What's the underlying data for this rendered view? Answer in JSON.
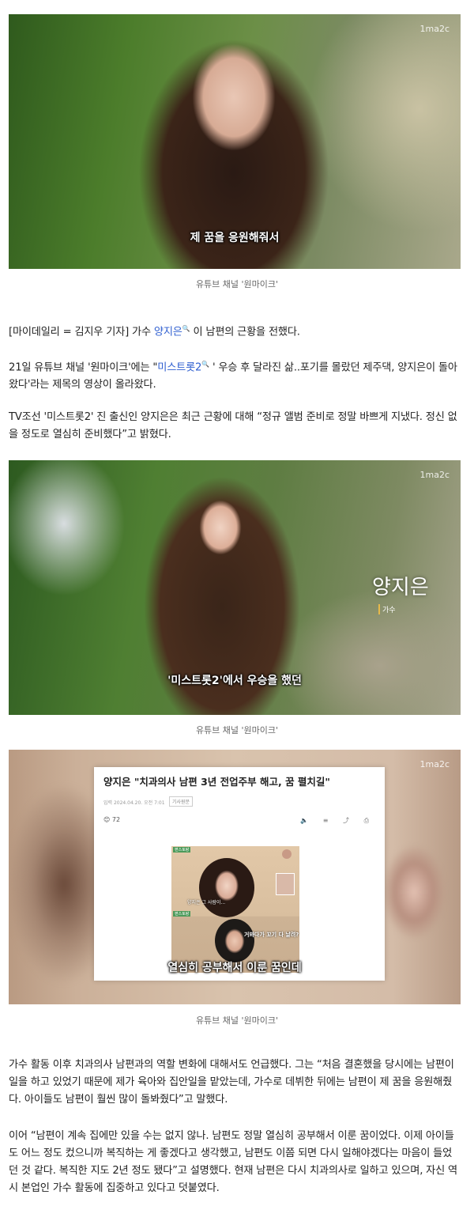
{
  "image1": {
    "watermark": "1ma2c",
    "subtitle": "제 꿈을 응원해줘서",
    "caption": "유튜브 채널 '원마이크'"
  },
  "paragraph1": {
    "prefix": "[마이데일리 = 김지우 기자] 가수 ",
    "link": "양지은",
    "suffix": " 이 남편의 근황을 전했다."
  },
  "paragraph2": {
    "prefix": "21일 유튜브 채널 '원마이크'에는 \"",
    "link": "미스트롯2",
    "suffix": " ' 우승 후 달라진 삶..포기를 몰랐던 제주댁, 양지은이 돌아왔다'라는 제목의 영상이 올라왔다."
  },
  "paragraph3": "TV조선 '미스트롯2' 진 출신인 양지은은 최근 근황에 대해 “정규 앨범 준비로 정말 바쁘게 지냈다. 정신 없을 정도로 열심히 준비했다”고 밝혔다.",
  "image2": {
    "watermark": "1ma2c",
    "name": "양지은",
    "role": "가수",
    "subtitle": "'미스트롯2'에서 우승을 했던",
    "caption": "유튜브 채널 '원마이크'"
  },
  "image3": {
    "watermark": "1ma2c",
    "article_title": "양지은 \"치과의사 남편 3년 전업주부 해고, 꿈 펼치길\"",
    "article_meta": "입력 2024.04.20. 오전 7:01",
    "article_category": "기사원문",
    "reaction": "😊 72",
    "tools": "🔈 ≡ ⤴ ⎙",
    "still_label_top": "편스토랑",
    "still_label_bottom": "편스토랑",
    "still_subtitle_top": "양지은 그 사람이...",
    "still_subtitle_bottom": "거봐다가 꼬기 다 날려?",
    "subtitle": "열심히 공부해서 이룬 꿈인데",
    "caption": "유튜브 채널 '원마이크'"
  },
  "paragraph4": "가수 활동 이후 치과의사 남편과의 역할 변화에 대해서도 언급했다. 그는 “처음 결혼했을 당시에는 남편이 일을 하고 있었기 때문에 제가 육아와 집안일을 맡았는데, 가수로 데뷔한 뒤에는 남편이 제 꿈을 응원해줬다. 아이들도 남편이 훨씬 많이 돌봐줬다”고 말했다.",
  "paragraph5": "이어 “남편이 계속 집에만 있을 수는 없지 않나. 남편도 정말 열심히 공부해서 이룬 꿈이었다. 이제 아이들도 어느 정도 컸으니까 복직하는 게 좋겠다고 생각했고, 남편도 이쯤 되면 다시 일해야겠다는 마음이 들었던 것 같다. 복직한 지도 2년 정도 됐다”고 설명했다. 현재 남편은 다시 치과의사로 일하고 있으며, 자신 역시 본업인 가수 활동에 집중하고 있다고 덧붙였다.",
  "colors": {
    "link": "#2f5fd0",
    "caption": "#666666",
    "body": "#222222"
  }
}
